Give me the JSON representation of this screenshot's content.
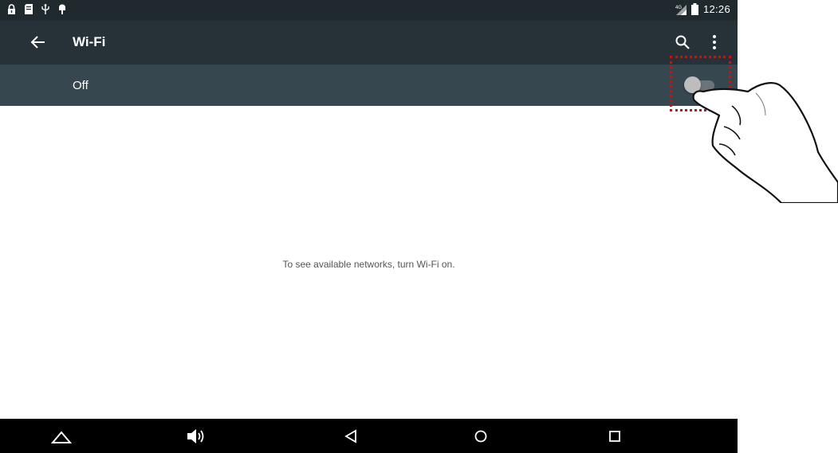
{
  "status_bar": {
    "time": "12:26",
    "left_icons": [
      "lock-icon",
      "sd-card-icon",
      "usb-icon",
      "android-debug-icon"
    ],
    "right_icons": [
      "signal-icon",
      "battery-icon"
    ]
  },
  "toolbar": {
    "title": "Wi-Fi",
    "icons": [
      "back-arrow-icon",
      "search-icon",
      "overflow-menu-icon"
    ]
  },
  "wifi_switch": {
    "label": "Off",
    "state": "off"
  },
  "empty_state": {
    "message": "To see available networks, turn Wi-Fi on."
  },
  "nav_bar": {
    "icons": [
      "collapse-icon",
      "volume-icon",
      "back-icon",
      "home-icon",
      "recents-icon"
    ]
  },
  "annotation": {
    "highlight_color": "#cc1111"
  },
  "colors": {
    "status_bar": "#20292e",
    "toolbar": "#263238",
    "switch_bar": "#37474f",
    "nav_bar": "#000000"
  }
}
